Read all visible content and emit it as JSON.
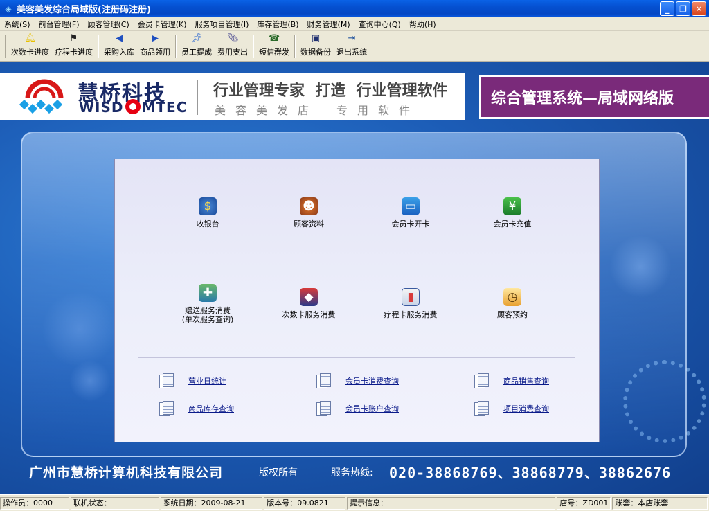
{
  "window": {
    "title": "美容美发综合局域版(注册码注册)"
  },
  "menu": [
    "系统(S)",
    "前台管理(F)",
    "顾客管理(C)",
    "会员卡管理(K)",
    "服务项目管理(I)",
    "库存管理(B)",
    "财务管理(M)",
    "查询中心(Q)",
    "帮助(H)"
  ],
  "toolbar": [
    {
      "label": "次数卡进度",
      "icon": "bell-icon",
      "color": "#e8c000"
    },
    {
      "label": "疗程卡进度",
      "icon": "checker-flag-icon",
      "color": "#222222"
    },
    {
      "label": "采购入库",
      "icon": "arrow-left-icon",
      "color": "#2050c0"
    },
    {
      "label": "商品领用",
      "icon": "arrow-right-icon",
      "color": "#2050c0"
    },
    {
      "label": "员工提成",
      "icon": "pin-icon",
      "color": "#2060d0"
    },
    {
      "label": "费用支出",
      "icon": "paperclip-icon",
      "color": "#3a3a8a"
    },
    {
      "label": "短信群发",
      "icon": "phone-icon",
      "color": "#2a6a2a"
    },
    {
      "label": "数据备份",
      "icon": "floppy-disk-icon",
      "color": "#203070"
    },
    {
      "label": "退出系统",
      "icon": "exit-door-icon",
      "color": "#2a5aa0"
    }
  ],
  "brand": {
    "name_cn": "慧桥科技",
    "name_en_left": "WISD",
    "name_en_right": "MTEC",
    "slogan_line1": "行业管理专家  打造  行业管理软件",
    "slogan_line2_left": "美容美发店",
    "slogan_line2_right": "专用软件",
    "edition": "综合管理系统—局域网络版"
  },
  "functions": {
    "cashier": "收银台",
    "customer_info": "顾客资料",
    "card_open": "会员卡开卡",
    "card_recharge": "会员卡充值",
    "gift_service_line1": "赠送服务消费",
    "gift_service_line2": "(单次服务查询)",
    "count_card_service": "次数卡服务消费",
    "course_card_service": "疗程卡服务消费",
    "appointment": "顾客预约"
  },
  "queries": {
    "daily_stats": "营业日统计",
    "card_consumption": "会员卡消费查询",
    "goods_sales": "商品销售查询",
    "goods_stock": "商品库存查询",
    "card_account": "会员卡账户查询",
    "item_consumption": "项目消费查询"
  },
  "footer": {
    "company": "广州市慧桥计算机科技有限公司",
    "copyright": "版权所有",
    "hotline_label": "服务热线:",
    "hotline": "020-38868769、38868779、38862676"
  },
  "status": {
    "operator": "操作员：0000",
    "online": "联机状态：",
    "date": "系统日期：2009-08-21",
    "version": "版本号：09.0821",
    "tips": "提示信息：",
    "store": "店号：ZD001",
    "account": "账套：本店账套"
  },
  "colors": {
    "brand_purple": "#7a2a7a",
    "link_blue": "#0a1a8a",
    "background_blue": "#1c5cb6"
  }
}
